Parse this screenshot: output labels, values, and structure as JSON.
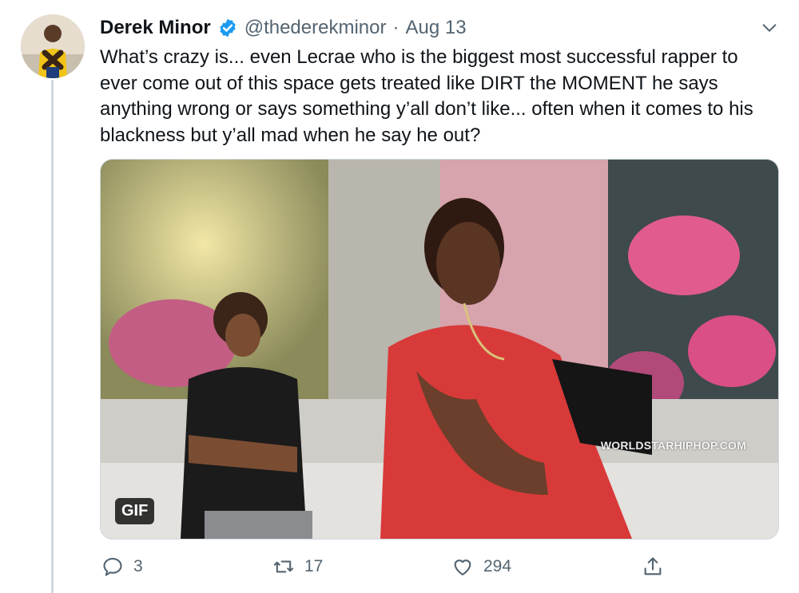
{
  "tweet": {
    "author_name": "Derek Minor",
    "handle": "@thederekminor",
    "separator": "·",
    "date": "Aug 13",
    "text": "What’s crazy is... even Lecrae who is the biggest most successful rapper to ever come out of this space gets treated like DIRT the MOMENT he says anything wrong or says something y’all don’t like... often when it comes to his blackness but y’all mad when he say he out?",
    "media": {
      "badge": "GIF",
      "watermark": "WORLDSTARHIPHOP.COM"
    },
    "actions": {
      "reply_count": "3",
      "retweet_count": "17",
      "like_count": "294"
    }
  },
  "icons": {
    "verified": "verified-badge-icon",
    "more": "chevron-down-icon",
    "reply": "reply-icon",
    "retweet": "retweet-icon",
    "like": "heart-icon",
    "share": "share-icon"
  },
  "colors": {
    "verified_blue": "#1d9bf0",
    "secondary_text": "#536471",
    "primary_text": "#0f1419"
  }
}
